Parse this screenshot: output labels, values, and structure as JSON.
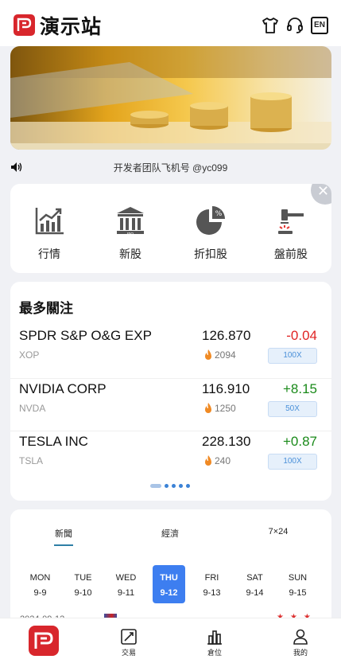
{
  "header": {
    "app_title": "演示站",
    "icons": [
      "shirt-icon",
      "headset-icon"
    ],
    "lang_label": "EN"
  },
  "banner": {
    "image": "coins-and-calculator-banner"
  },
  "notice": {
    "text": "开发者团队飞机号 @yc099"
  },
  "quick_menu": {
    "items": [
      {
        "label": "行情",
        "icon": "market-chart-icon"
      },
      {
        "label": "新股",
        "icon": "ipo-building-icon"
      },
      {
        "label": "折扣股",
        "icon": "discount-pie-icon"
      },
      {
        "label": "盤前股",
        "icon": "premarket-gavel-icon"
      }
    ]
  },
  "watchlist": {
    "title": "最多關注",
    "rows": [
      {
        "name": "SPDR S&P O&G EXP",
        "code": "XOP",
        "price": "126.870",
        "change": "-0.04",
        "direction": "down",
        "heat": "2094",
        "leverage": "100X"
      },
      {
        "name": "NVIDIA CORP",
        "code": "NVDA",
        "price": "116.910",
        "change": "+8.15",
        "direction": "up",
        "heat": "1250",
        "leverage": "50X"
      },
      {
        "name": "TESLA INC",
        "code": "TSLA",
        "price": "228.130",
        "change": "+0.87",
        "direction": "up",
        "heat": "240",
        "leverage": "100X"
      }
    ],
    "colors": {
      "up": "#1a8a1a",
      "down": "#e02424"
    }
  },
  "news": {
    "tabs": [
      {
        "label": "新聞",
        "active": true
      },
      {
        "label": "經濟",
        "active": false
      },
      {
        "label": "7×24",
        "active": false
      }
    ],
    "days": [
      {
        "name": "MON",
        "date": "9-9"
      },
      {
        "name": "TUE",
        "date": "9-10"
      },
      {
        "name": "WED",
        "date": "9-11"
      },
      {
        "name": "THU",
        "date": "9-12",
        "active": true
      },
      {
        "name": "FRI",
        "date": "9-13"
      },
      {
        "name": "SAT",
        "date": "9-14"
      },
      {
        "name": "SUN",
        "date": "9-15"
      }
    ],
    "peek_date": "2024-09-12"
  },
  "tabbar": {
    "items": [
      {
        "label": "",
        "icon": "home-logo-icon"
      },
      {
        "label": "交易",
        "icon": "trade-chart-icon"
      },
      {
        "label": "倉位",
        "icon": "position-bars-icon"
      },
      {
        "label": "我的",
        "icon": "user-icon"
      }
    ]
  }
}
